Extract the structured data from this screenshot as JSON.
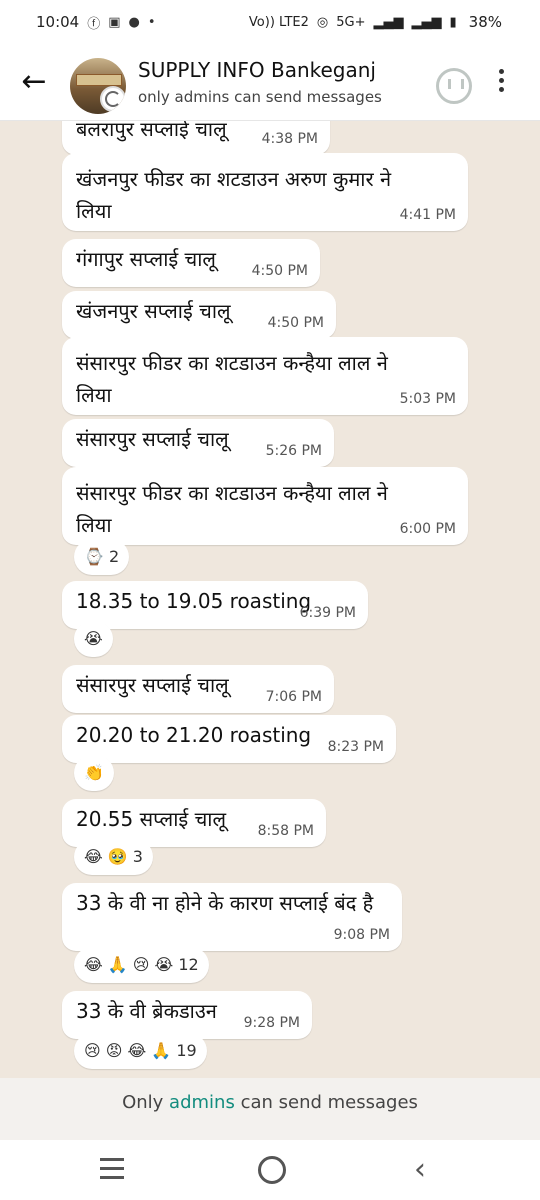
{
  "status_bar": {
    "time": "10:04",
    "network": "Vo)) LTE2",
    "signal": "5G+",
    "battery": "38%"
  },
  "header": {
    "title": "SUPPLY INFO Bankeganj",
    "subtitle": "only admins can send messages"
  },
  "messages": [
    {
      "text": "बलरापुर सप्लाई चालू",
      "time": "4:38 PM"
    },
    {
      "text": "खंजनपुर फीडर का शटडाउन अरुण कुमार ने लिया",
      "time": "4:41 PM"
    },
    {
      "text": "गंगापुर सप्लाई चालू",
      "time": "4:50 PM"
    },
    {
      "text": "खंजनपुर सप्लाई चालू",
      "time": "4:50 PM"
    },
    {
      "text": "संसारपुर फीडर का शटडाउन कन्हैया लाल ने लिया",
      "time": "5:03 PM"
    },
    {
      "text": "संसारपुर सप्लाई चालू",
      "time": "5:26 PM"
    },
    {
      "text": "संसारपुर फीडर का शटडाउन कन्हैया लाल ने लिया",
      "time": "6:00 PM",
      "reactions": "⌚ 2"
    },
    {
      "text": "18.35 to 19.05 roasting",
      "time": "6:39 PM",
      "reactions": "😭"
    },
    {
      "text": "संसारपुर सप्लाई चालू",
      "time": "7:06 PM"
    },
    {
      "text": "20.20 to 21.20 roasting",
      "time": "8:23 PM",
      "reactions": "👏"
    },
    {
      "text": "20.55 सप्लाई चालू",
      "time": "8:58 PM",
      "reactions": "😂 🥹 3"
    },
    {
      "text": "33 के वी ना होने के कारण सप्लाई बंद है",
      "time": "9:08 PM",
      "reactions": "😂 🙏 😢 😭 12"
    },
    {
      "text": "33 के वी ब्रेकडाउन",
      "time": "9:28 PM",
      "reactions": "😢 😡 😂 🙏 19"
    }
  ],
  "footer": {
    "note_pre": "Only",
    "note_link": "admins",
    "note_post": "can send messages"
  }
}
